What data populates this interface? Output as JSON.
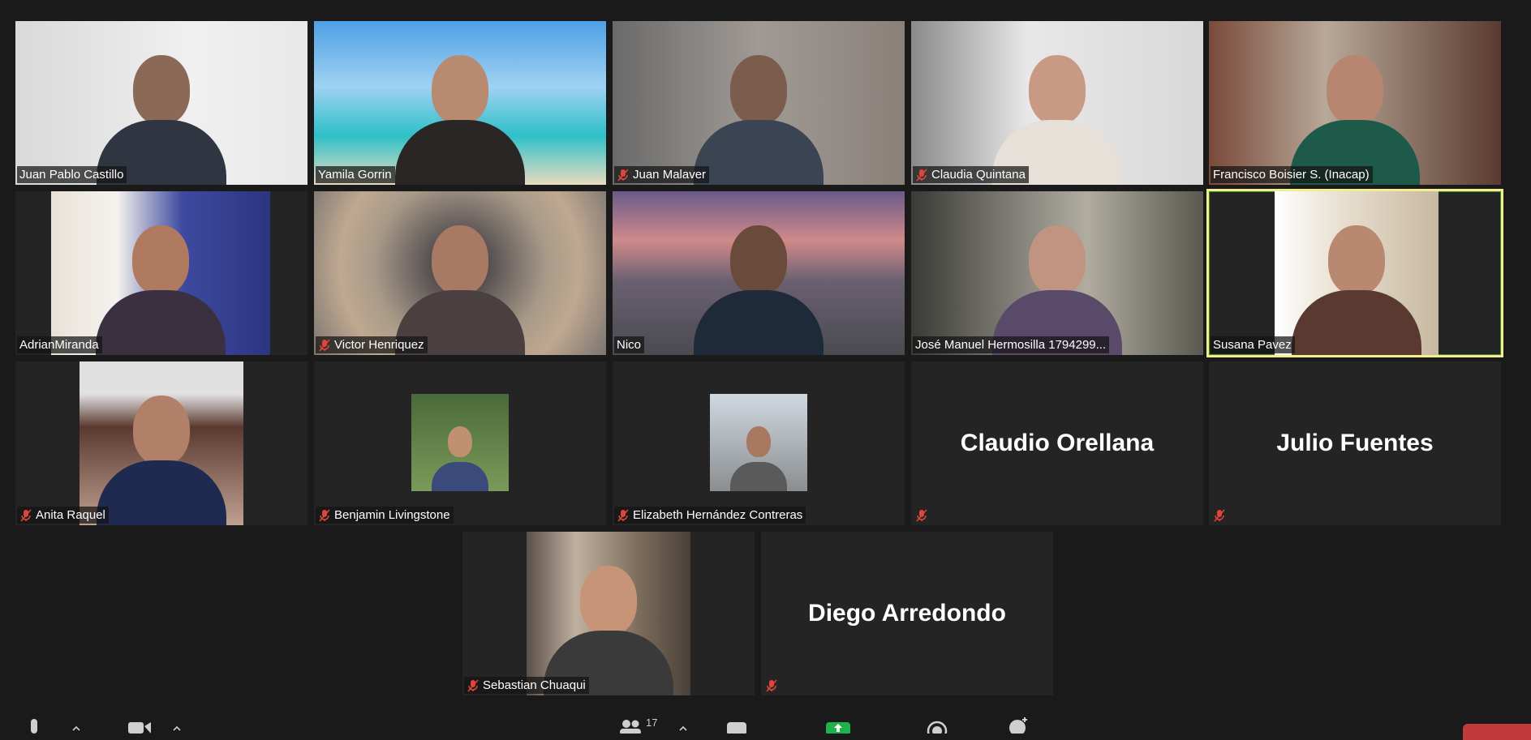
{
  "participants": [
    {
      "name": "Juan Pablo Castillo",
      "muted": false
    },
    {
      "name": "Yamila Gorrin",
      "muted": false
    },
    {
      "name": "Juan Malaver",
      "muted": true
    },
    {
      "name": "Claudia Quintana",
      "muted": true
    },
    {
      "name": "Francisco Boisier S. (Inacap)",
      "muted": false
    },
    {
      "name": "AdrianMiranda",
      "muted": false
    },
    {
      "name": "Victor Henriquez",
      "muted": true
    },
    {
      "name": "Nico",
      "muted": false
    },
    {
      "name": "José Manuel Hermosilla 1794299...",
      "muted": false
    },
    {
      "name": "Susana Pavez",
      "muted": false,
      "active": true
    },
    {
      "name": "Anita Raquel",
      "muted": true
    },
    {
      "name": "Benjamin Livingstone",
      "muted": true
    },
    {
      "name": "Elizabeth Hernández Contreras",
      "muted": true
    },
    {
      "name": "Claudio Orellana",
      "muted": true,
      "video_off": true
    },
    {
      "name": "Julio Fuentes",
      "muted": true,
      "video_off": true
    },
    {
      "name": "Sebastian Chuaqui",
      "muted": true
    },
    {
      "name": "Diego Arredondo",
      "muted": true,
      "video_off": true
    }
  ],
  "toolbar": {
    "participants_count": "17",
    "colors": {
      "share": "#1fb24a",
      "end": "#c23a3a"
    }
  },
  "colors": {
    "active_border": "#f2ef8b",
    "mute_red": "#e0453a"
  }
}
